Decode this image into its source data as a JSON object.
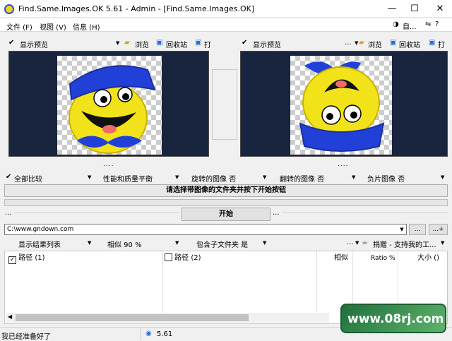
{
  "window": {
    "title": "Find.Same.Images.OK 5.61 - Admin - [Find.Same.Images.OK]",
    "minimize": "—",
    "maximize": "☐",
    "close": "✕"
  },
  "menu": {
    "items": [
      "文件 (F)",
      "视图 (V)",
      "信息 (H)"
    ],
    "right_user": "自...",
    "right_help": "?"
  },
  "left_pane": {
    "preview_label": "显示预览",
    "browse_label": "浏览",
    "recycle_label": "回收站",
    "open_label": "打"
  },
  "right_pane": {
    "preview_label": "显示预览",
    "browse_label": "浏览",
    "recycle_label": "回收站",
    "open_label": "打"
  },
  "dots": "....",
  "options": {
    "compare_all": "全部比较",
    "performance": "性能和质量平衡",
    "rotated": "旋转的图像  否",
    "flipped": "翻转的图像  否",
    "negative": "负片图像  否"
  },
  "status_message": "请选择带图像的文件夹并按下开始按钮",
  "start_button": "开始",
  "side_dots": "...",
  "path": {
    "value": "C:\\www.gndown.com",
    "browse_button": "...",
    "add_button": "...+"
  },
  "results": {
    "show_list": "显示结果列表",
    "similarity": "相似  90 %",
    "subfolders": "包含子文件夹  是",
    "donate": "捐赠 - 支持我的工..."
  },
  "table": {
    "col_path1": "路径 (1)",
    "col_path2": "路径 (2)",
    "col_similar": "相似",
    "col_ratio": "Ratio %",
    "col_size": "大小 ()",
    "check1": "✓"
  },
  "statusbar": {
    "ready": "我已经准备好了",
    "version": "5.61"
  },
  "watermark": "www.08rj.com",
  "colors": {
    "preview_bg": "#19253f",
    "smiley_yellow": "#f2e21a",
    "hat_blue": "#2140d8"
  }
}
